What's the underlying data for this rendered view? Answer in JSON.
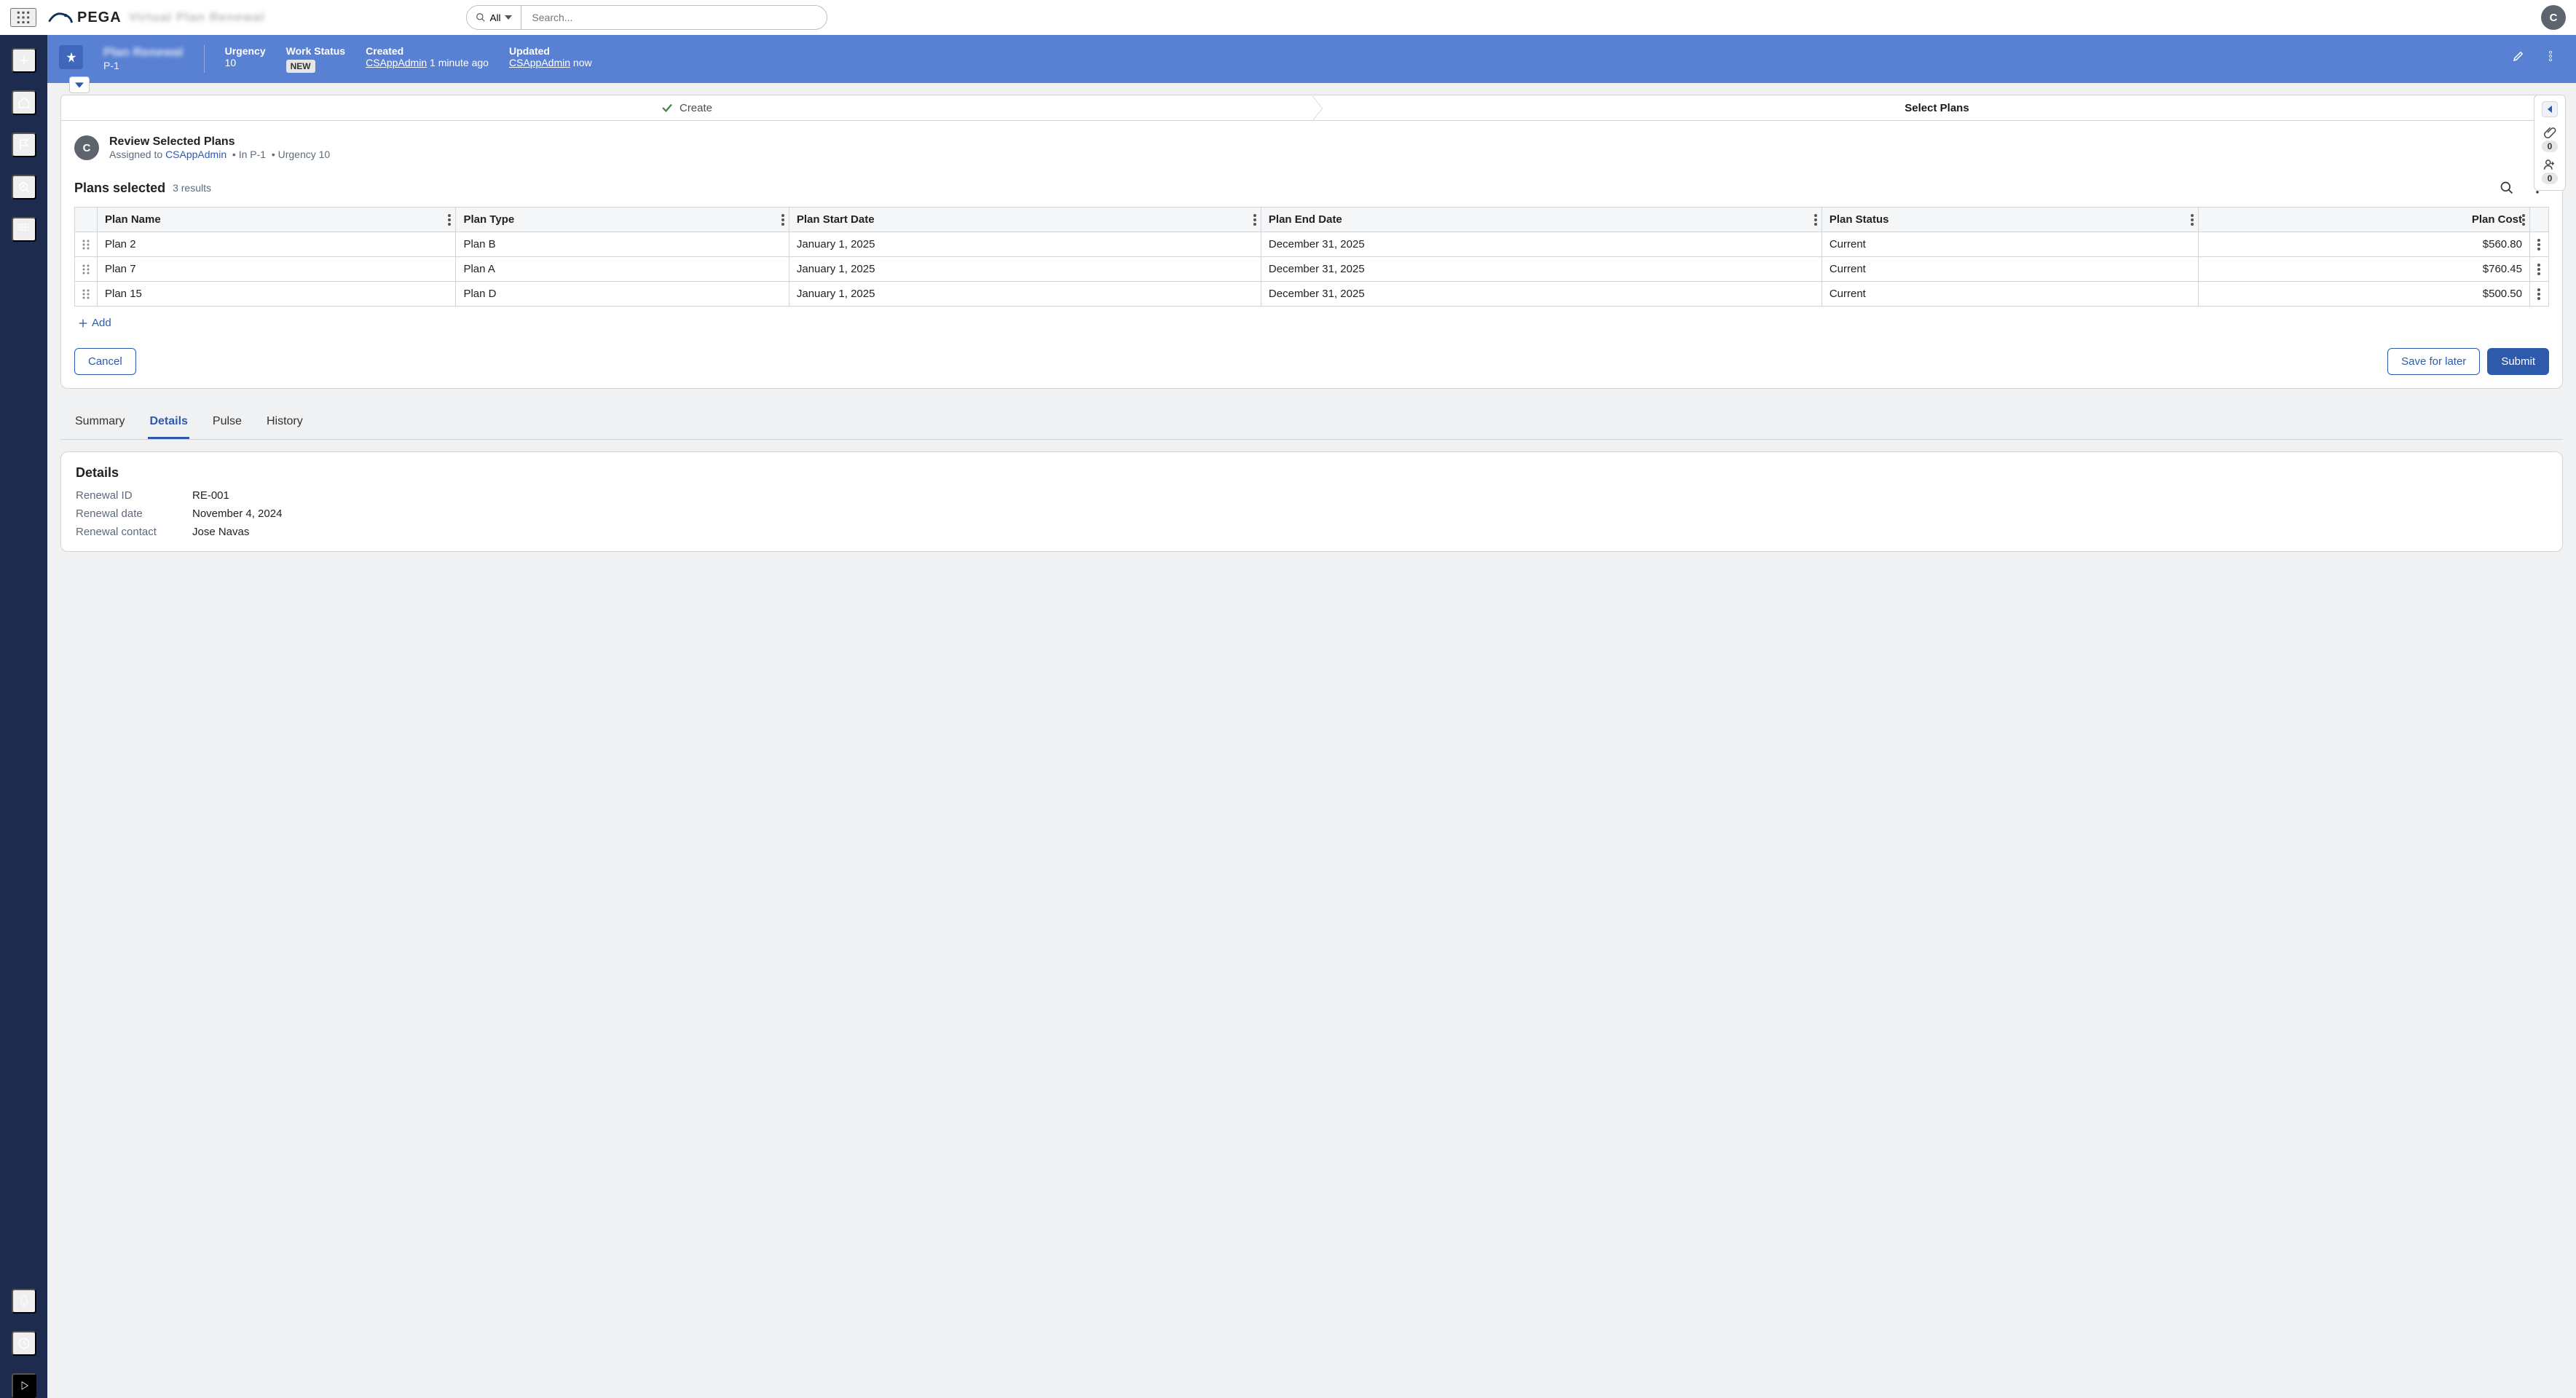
{
  "header": {
    "brand": "PEGA",
    "blurred_title": "Virtual Plan Renewal",
    "search_scope_label": "All",
    "search_placeholder": "Search...",
    "avatar_initial": "C"
  },
  "case": {
    "title_blurred": "Plan Renewal",
    "id": "P-1",
    "urgency_label": "Urgency",
    "urgency_value": "10",
    "work_status_label": "Work Status",
    "work_status_value": "NEW",
    "created_label": "Created",
    "created_user": "CSAppAdmin",
    "created_ago": "1 minute ago",
    "updated_label": "Updated",
    "updated_user": "CSAppAdmin",
    "updated_ago": "now"
  },
  "stages": {
    "complete": "Create",
    "current": "Select Plans"
  },
  "assignment": {
    "avatar_initial": "C",
    "title": "Review Selected Plans",
    "assigned_to_label": "Assigned to",
    "assigned_to_user": "CSAppAdmin",
    "in_case": "In P-1",
    "urgency": "Urgency 10"
  },
  "plans": {
    "heading": "Plans selected",
    "count": "3 results",
    "add_label": "Add",
    "columns": {
      "name": "Plan Name",
      "type": "Plan Type",
      "start": "Plan Start Date",
      "end": "Plan End Date",
      "status": "Plan Status",
      "cost": "Plan Cost"
    },
    "rows": [
      {
        "name": "Plan 2",
        "type": "Plan B",
        "start": "January 1, 2025",
        "end": "December 31, 2025",
        "status": "Current",
        "cost": "$560.80"
      },
      {
        "name": "Plan 7",
        "type": "Plan A",
        "start": "January 1, 2025",
        "end": "December 31, 2025",
        "status": "Current",
        "cost": "$760.45"
      },
      {
        "name": "Plan 15",
        "type": "Plan D",
        "start": "January 1, 2025",
        "end": "December 31, 2025",
        "status": "Current",
        "cost": "$500.50"
      }
    ]
  },
  "actions": {
    "cancel": "Cancel",
    "save_for_later": "Save for later",
    "submit": "Submit"
  },
  "tabs": {
    "summary": "Summary",
    "details": "Details",
    "pulse": "Pulse",
    "history": "History"
  },
  "details_panel": {
    "heading": "Details",
    "fields": {
      "renewal_id_label": "Renewal ID",
      "renewal_id_value": "RE-001",
      "renewal_date_label": "Renewal date",
      "renewal_date_value": "November 4, 2024",
      "renewal_contact_label": "Renewal contact",
      "renewal_contact_value": "Jose Navas"
    }
  },
  "utility": {
    "attachments_count": "0",
    "followers_count": "0"
  }
}
